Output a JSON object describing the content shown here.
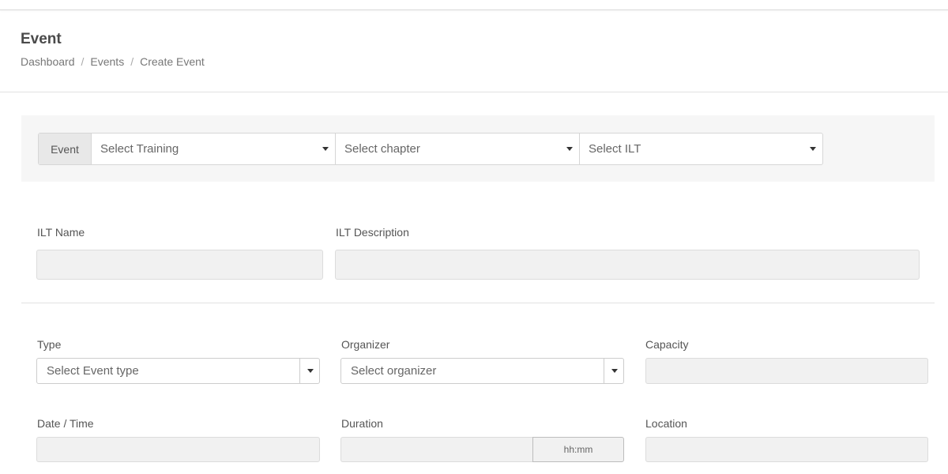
{
  "header": {
    "title": "Event",
    "breadcrumb": [
      "Dashboard",
      "Events",
      "Create Event"
    ]
  },
  "filters": {
    "addon": "Event",
    "training_placeholder": "Select Training",
    "chapter_placeholder": "Select chapter",
    "ilt_placeholder": "Select ILT"
  },
  "ilt": {
    "name_label": "ILT Name",
    "description_label": "ILT Description",
    "name_value": "",
    "description_value": ""
  },
  "form": {
    "type_label": "Type",
    "type_placeholder": "Select Event type",
    "organizer_label": "Organizer",
    "organizer_placeholder": "Select organizer",
    "capacity_label": "Capacity",
    "capacity_value": "",
    "datetime_label": "Date / Time",
    "datetime_value": "",
    "duration_label": "Duration",
    "duration_value": "",
    "duration_unit": "hh:mm",
    "location_label": "Location",
    "location_value": ""
  },
  "icons": {
    "dropdown": "caret-down-icon"
  },
  "colors": {
    "panel_bg": "#f6f6f6",
    "readonly_bg": "#f1f1f1",
    "addon_bg": "#e8e8e8",
    "text": "#555555"
  }
}
